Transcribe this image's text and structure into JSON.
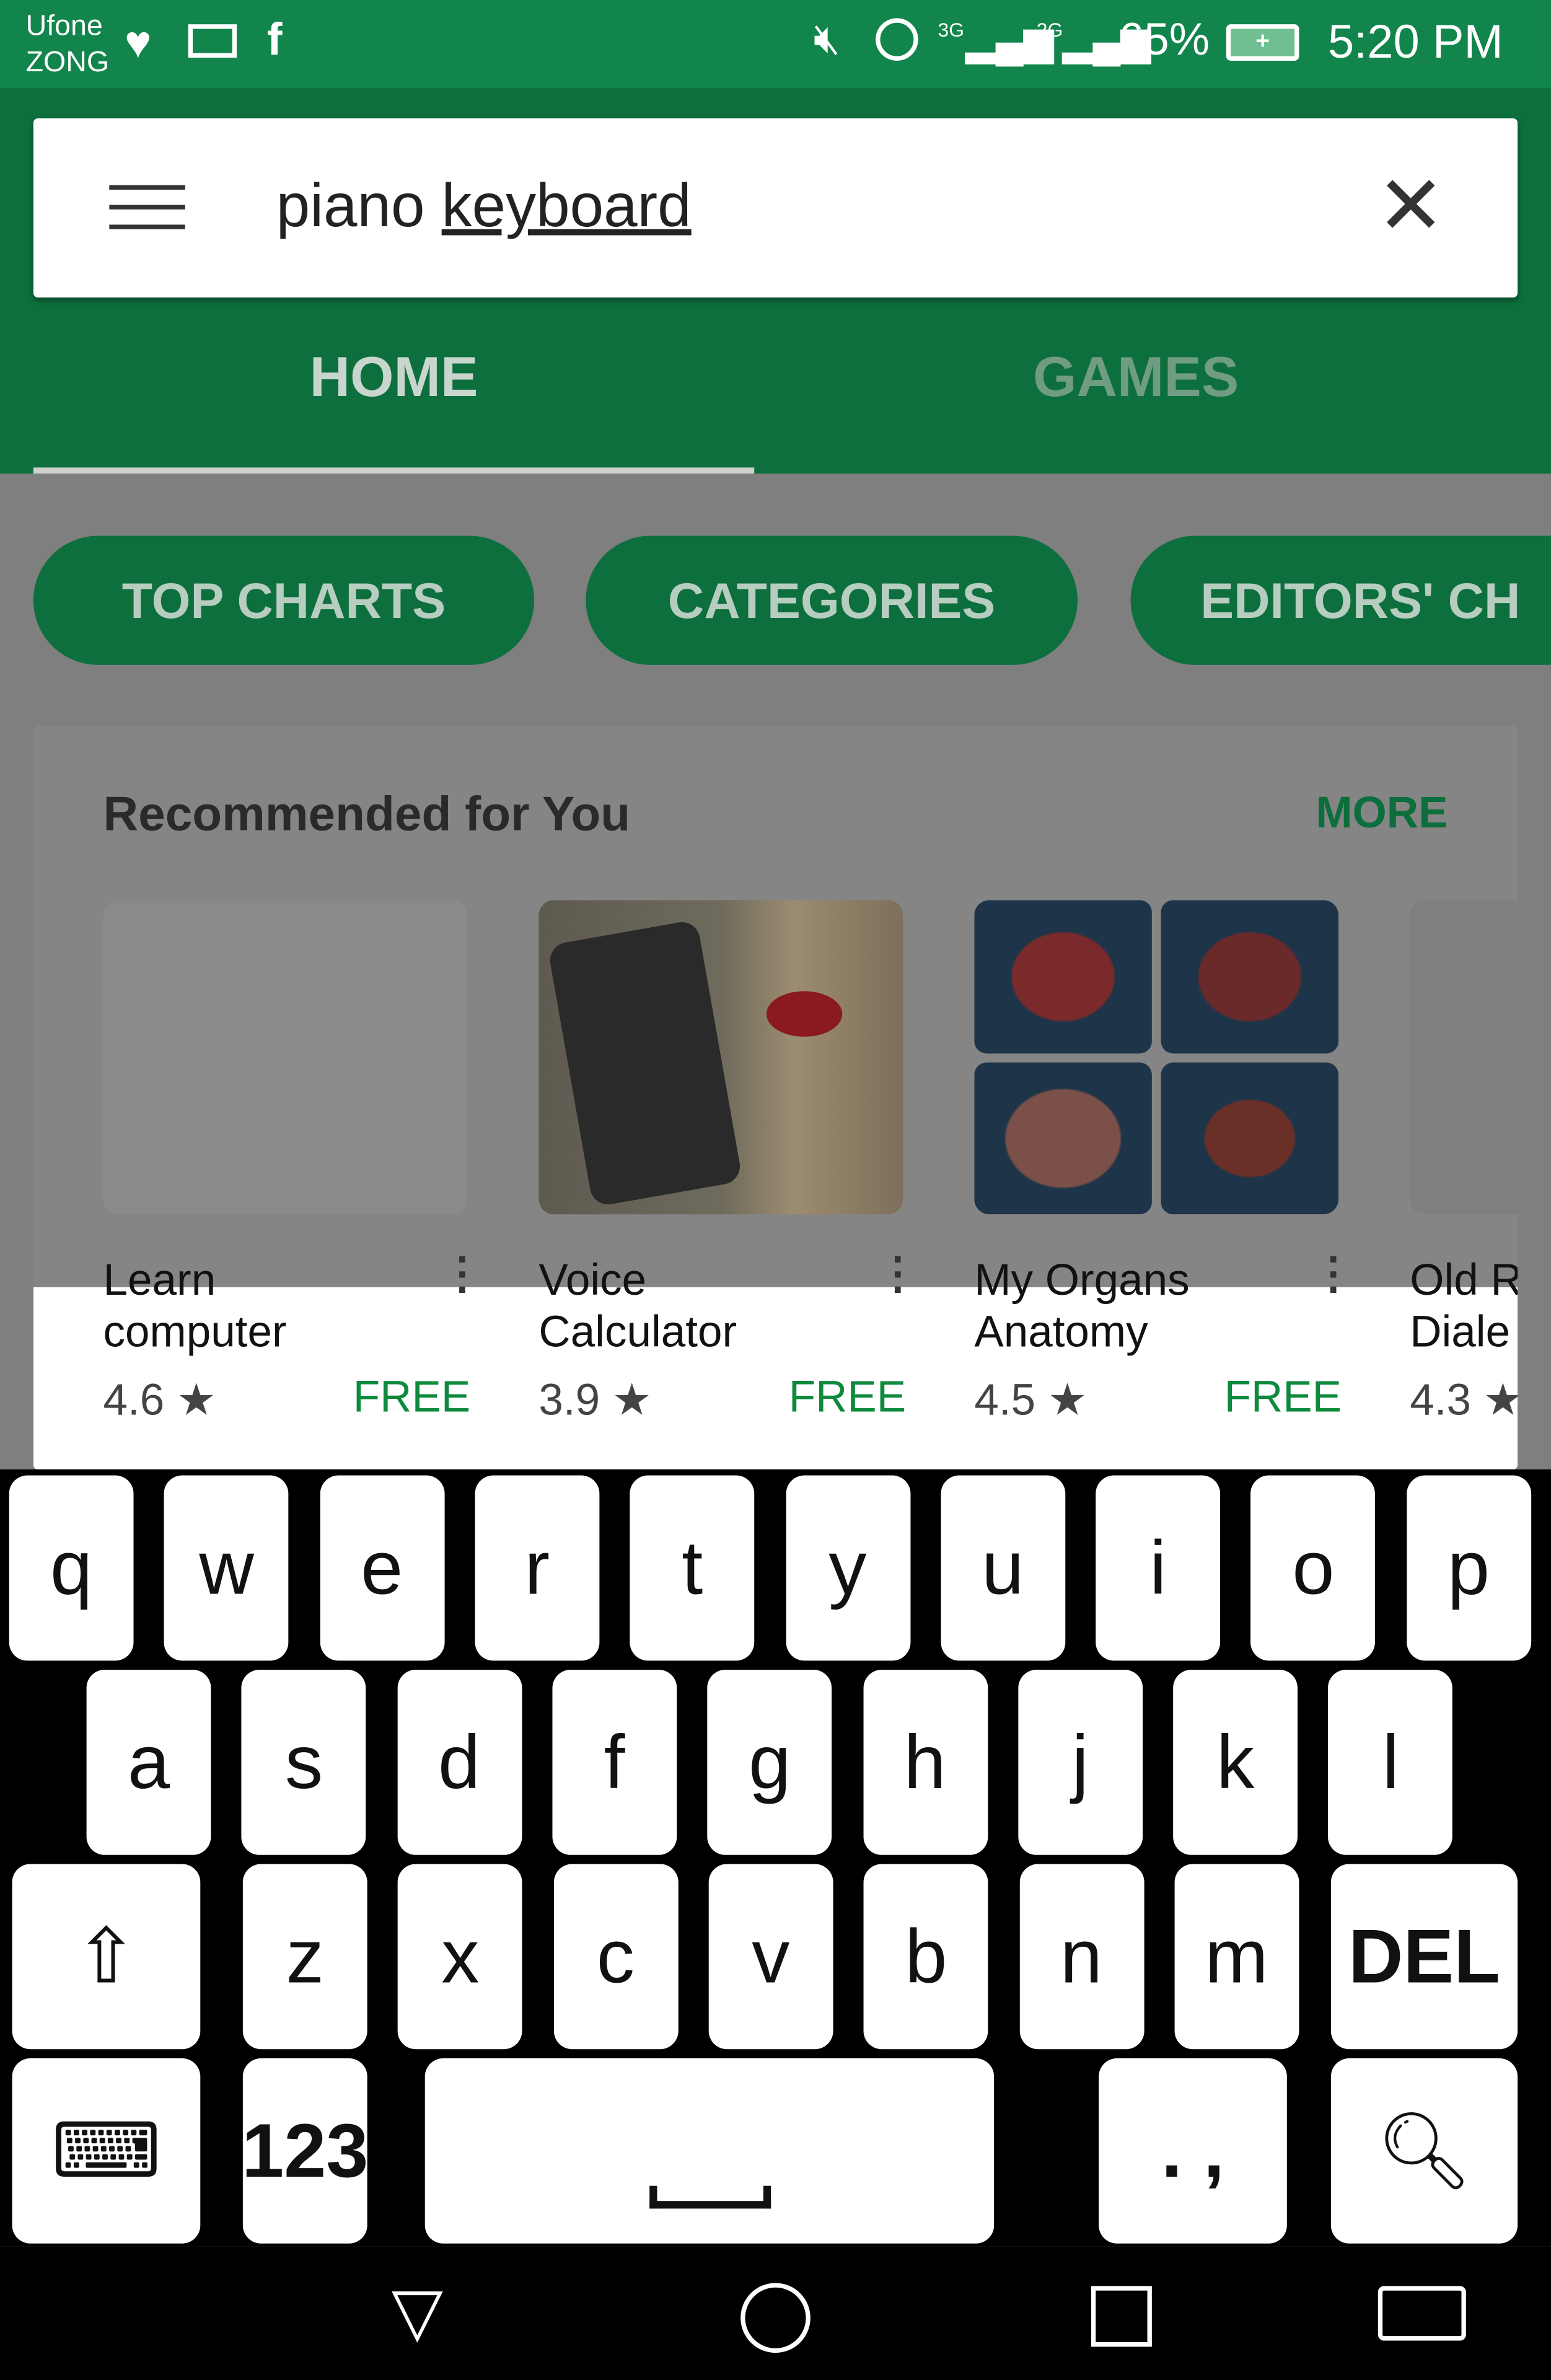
{
  "status_bar": {
    "carrier1": "Ufone",
    "carrier2": "ZONG",
    "net1": "3G",
    "net2": "2G",
    "battery": "65%",
    "time": "5:20 PM",
    "left_icons": [
      "health-heart-icon",
      "mail-icon",
      "facebook-icon"
    ],
    "right_icons": [
      "mute-icon",
      "alarm-icon",
      "signal-icon",
      "signal-icon",
      "battery-charging-icon"
    ]
  },
  "search": {
    "query_plain": "piano ",
    "query_underlined": "keyboard"
  },
  "tabs": [
    {
      "label": "HOME",
      "active": true
    },
    {
      "label": "GAMES",
      "active": false
    }
  ],
  "chips": [
    {
      "label": "TOP CHARTS"
    },
    {
      "label": "CATEGORIES"
    },
    {
      "label": "EDITORS' CH"
    }
  ],
  "section": {
    "title": "Recommended for You",
    "more": "MORE"
  },
  "apps": [
    {
      "line1": "Learn",
      "line2": "computer",
      "rating": "4.6 ★",
      "price": "FREE"
    },
    {
      "line1": "Voice",
      "line2": "Calculator",
      "rating": "3.9 ★",
      "price": "FREE"
    },
    {
      "line1": "My Organs",
      "line2": "Anatomy",
      "rating": "4.5 ★",
      "price": "FREE"
    },
    {
      "line1": "Old R",
      "line2": "Diale",
      "rating": "4.3 ★",
      "price": ""
    }
  ],
  "keyboard": {
    "row1": [
      "q",
      "w",
      "e",
      "r",
      "t",
      "y",
      "u",
      "i",
      "o",
      "p"
    ],
    "row2": [
      "a",
      "s",
      "d",
      "f",
      "g",
      "h",
      "j",
      "k",
      "l"
    ],
    "row3": [
      "z",
      "x",
      "c",
      "v",
      "b",
      "n",
      "m"
    ],
    "del": "DEL",
    "numbers": "123",
    "punct": ". ,"
  },
  "colors": {
    "status": "#12854c",
    "appbar": "#0d6f3d",
    "free": "#0d8a3c"
  }
}
